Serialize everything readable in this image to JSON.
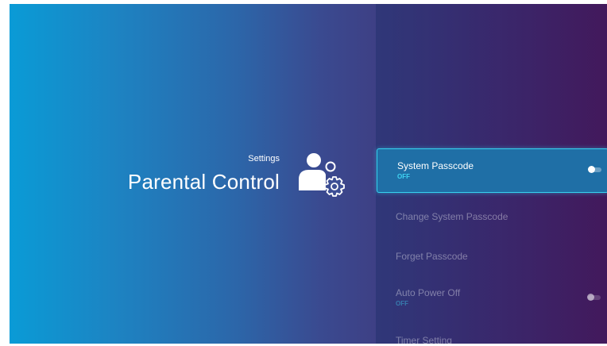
{
  "header": {
    "breadcrumb": "Settings",
    "title": "Parental Control",
    "title_icon": "parental-control-icon"
  },
  "menu": {
    "items": [
      {
        "label": "System Passcode",
        "sublabel": "OFF",
        "toggle": "off",
        "selected": true
      },
      {
        "label": "Change System Passcode"
      },
      {
        "label": "Forget Passcode"
      },
      {
        "label": "Auto Power Off",
        "sublabel": "OFF",
        "toggle": "off"
      },
      {
        "label": "Timer Setting"
      }
    ]
  },
  "colors": {
    "focus_border": "#36d2f0",
    "sublabel": "#3fd3f2",
    "gradient_left": "#0a9bd6",
    "gradient_right": "#411a5c"
  }
}
